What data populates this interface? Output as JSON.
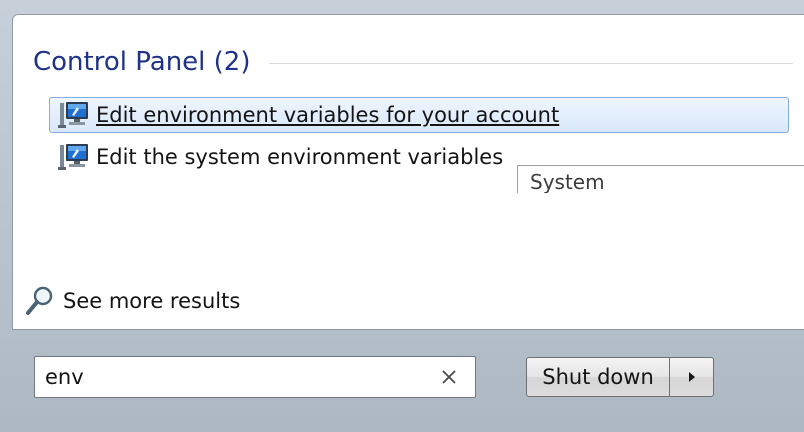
{
  "control_panel": {
    "title": "Control Panel (2)",
    "results": [
      {
        "label": "Edit environment variables for your account",
        "icon": "monitor-settings-icon",
        "selected": true
      },
      {
        "label": "Edit the system environment variables",
        "icon": "monitor-settings-icon",
        "selected": false
      }
    ]
  },
  "tooltip": {
    "text": "System"
  },
  "see_more": {
    "label": "See more results",
    "icon": "magnifier-icon"
  },
  "search": {
    "value": "env",
    "clear_icon": "clear-icon"
  },
  "shutdown": {
    "label": "Shut down",
    "arrow_icon": "triangle-right-icon"
  },
  "colors": {
    "section_title": "#1e3287",
    "selection_border": "#84acdd",
    "selection_fill": "#d9e8fa"
  }
}
